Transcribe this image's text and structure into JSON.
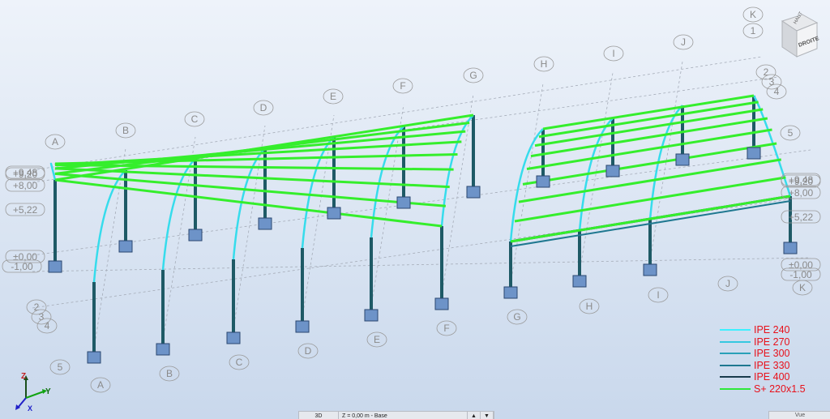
{
  "view": {
    "grid_front_letters": [
      "A",
      "B",
      "C",
      "D",
      "E",
      "F",
      "G",
      "H",
      "I",
      "J",
      "K"
    ],
    "grid_back_letters": [
      "A",
      "B",
      "C",
      "D",
      "E",
      "F",
      "G",
      "H",
      "I",
      "J",
      "K"
    ],
    "grid_left_numbers": [
      "2",
      "3",
      "4",
      "5"
    ],
    "grid_right_numbers": [
      "1",
      "2",
      "3",
      "4",
      "5"
    ],
    "levels_left": [
      "+9,48",
      "+9,20",
      "+8,00",
      "+5,22",
      "±0,00",
      "-1,00"
    ],
    "levels_right": [
      "+9,48",
      "+9,20",
      "+8,00",
      "+5,22",
      "±0,00",
      "-1,00"
    ]
  },
  "legend": {
    "items": [
      {
        "label": "IPE 240",
        "color": "#3ef0ff"
      },
      {
        "label": "IPE 270",
        "color": "#35c8e0"
      },
      {
        "label": "IPE 300",
        "color": "#2aa0b8"
      },
      {
        "label": "IPE 330",
        "color": "#1f7890"
      },
      {
        "label": "IPE 400",
        "color": "#173a4c"
      },
      {
        "label": "S+ 220x1.5",
        "color": "#2ee83a"
      }
    ]
  },
  "view_cube": {
    "face_top": "HAUT",
    "face_front": "DROITE"
  },
  "axes": {
    "x": "X",
    "y": "Y",
    "z": "Z"
  },
  "status_bar": {
    "view_mode": "3D",
    "level": "Z = 0,00 m - Base",
    "right_tab": "Vue"
  },
  "colors": {
    "column": "#1e5a66",
    "purlin": "#35ee2c",
    "rafter": "#36dcec",
    "footing": "#6d93c8"
  }
}
